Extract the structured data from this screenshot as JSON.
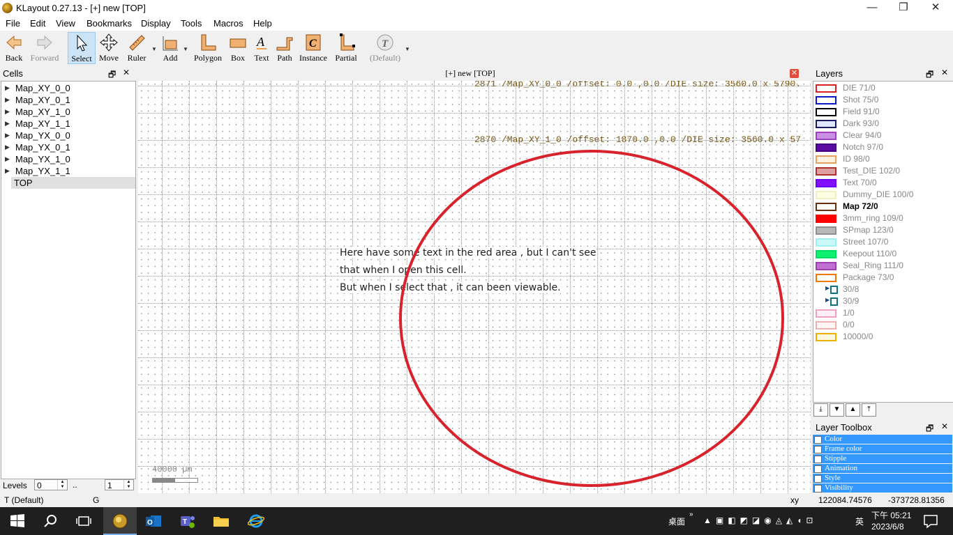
{
  "window": {
    "title": "KLayout 0.27.13 - [+] new [TOP]",
    "minimize": "—",
    "restore": "❐",
    "close": "✕"
  },
  "menu": [
    "File",
    "Edit",
    "View",
    "Bookmarks",
    "Display",
    "Tools",
    "Macros",
    "Help"
  ],
  "toolbar": {
    "back": "Back",
    "forward": "Forward",
    "select": "Select",
    "move": "Move",
    "ruler": "Ruler",
    "add": "Add",
    "polygon": "Polygon",
    "box": "Box",
    "text": "Text",
    "path": "Path",
    "instance": "Instance",
    "partial": "Partial",
    "default": "(Default)"
  },
  "cells": {
    "title": "Cells",
    "items": [
      "Map_XY_0_0",
      "Map_XY_0_1",
      "Map_XY_1_0",
      "Map_XY_1_1",
      "Map_YX_0_0",
      "Map_YX_0_1",
      "Map_YX_1_0",
      "Map_YX_1_1"
    ],
    "top": "TOP",
    "levels_label": "Levels",
    "levels_from": "0",
    "levels_sep": "..",
    "levels_to": "1"
  },
  "canvas": {
    "title": "[+] new [TOP]",
    "line1": "2871 /Map_XY_0_0 /offset: 0.0 ,0.0 /DIE size: 3560.0 x 5790.",
    "line2": "2870 /Map_XY_1_0 /offset: 1870.0 ,0.0 /DIE size: 3560.0 x 57",
    "note1": "Here have some text in the red area , but I can't see",
    "note2": "that when I open this cell.",
    "note3": "But when I select that , it can been viewable.",
    "scale": "40000 µm",
    "annotation_color": "#d8222c"
  },
  "layers": {
    "title": "Layers",
    "items": [
      {
        "name": "DIE 71/0",
        "frame": "#e0201f",
        "fill": "#ffffff"
      },
      {
        "name": "Shot 75/0",
        "frame": "#0a18c8",
        "fill": "#ffffff"
      },
      {
        "name": "Field 91/0",
        "frame": "#000000",
        "fill": "#ffffff"
      },
      {
        "name": "Dark 93/0",
        "frame": "#1a1a60",
        "fill": "#dfe6ff"
      },
      {
        "name": "Clear 94/0",
        "frame": "#a040c0",
        "fill": "#c890e0"
      },
      {
        "name": "Notch 97/0",
        "frame": "#400080",
        "fill": "#5a0aa0"
      },
      {
        "name": "ID 98/0",
        "frame": "#e8a060",
        "fill": "#fff0e0"
      },
      {
        "name": "Test_DIE 102/0",
        "frame": "#b03030",
        "fill": "#e0a0a0"
      },
      {
        "name": "Text 70/0",
        "frame": "#7000f0",
        "fill": "#8010ff"
      },
      {
        "name": "Dummy_DIE 100/0",
        "frame": "#f0f0c0",
        "fill": "#ffffe8"
      },
      {
        "name": "Map 72/0",
        "frame": "#6a3010",
        "fill": "#ffffff",
        "bold": true
      },
      {
        "name": "3mm_ring 109/0",
        "frame": "#ff0000",
        "fill": "#ff0000"
      },
      {
        "name": "SPmap 123/0",
        "frame": "#909090",
        "fill": "#b8b8b8"
      },
      {
        "name": "Street 107/0",
        "frame": "#a0f0f0",
        "fill": "#c8f8f8"
      },
      {
        "name": "Keepout 110/0",
        "frame": "#00e060",
        "fill": "#10f070"
      },
      {
        "name": "Seal_Ring 111/0",
        "frame": "#a040b0",
        "fill": "#c070d0"
      },
      {
        "name": "Package 73/0",
        "frame": "#f07800",
        "fill": "#ffffff"
      },
      {
        "name": "30/8",
        "frame": "#107080",
        "fill": "#ffffff",
        "group": true
      },
      {
        "name": "30/9",
        "frame": "#107080",
        "fill": "#ffffff",
        "group": true
      },
      {
        "name": "1/0",
        "frame": "#f0a0c0",
        "fill": "#fff0f5"
      },
      {
        "name": "0/0",
        "frame": "#f0b0b0",
        "fill": "#fff5f5"
      },
      {
        "name": "10000/0",
        "frame": "#f0b000",
        "fill": "#fff8e0"
      }
    ]
  },
  "toolbox": {
    "title": "Layer Toolbox",
    "rows": [
      "Color",
      "Frame color",
      "Stipple",
      "Animation",
      "Style",
      "Visibility"
    ]
  },
  "status": {
    "mode": "T  (Default)",
    "grid": "G",
    "xy": "xy",
    "x": "122084.74576",
    "y": "-373728.81356"
  },
  "taskbar": {
    "desktop": "桌面",
    "ime": "英",
    "time": "下午 05:21",
    "date": "2023/6/8"
  }
}
